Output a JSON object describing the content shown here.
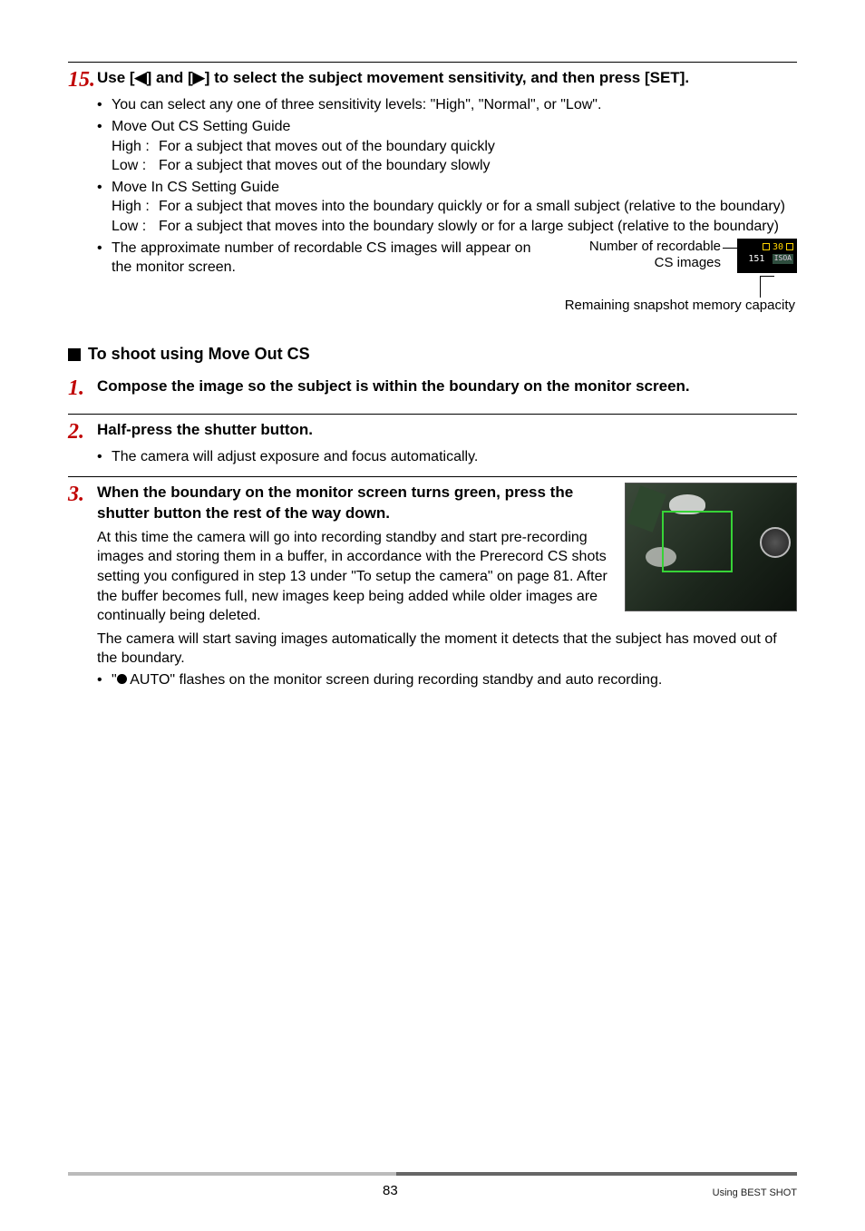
{
  "step15": {
    "num": "15.",
    "head": "Use [◀] and [▶] to select the subject movement sensitivity, and then press [SET].",
    "b1": "You can select any one of three sensitivity levels: \"High\", \"Normal\", or \"Low\".",
    "b2": "Move Out CS Setting Guide",
    "b2_high_lbl": "High :",
    "b2_high": "For a subject that moves out of the boundary quickly",
    "b2_low_lbl": "Low  :",
    "b2_low": "For a subject that moves out of the boundary slowly",
    "b3": "Move In CS Setting Guide",
    "b3_high_lbl": "High :",
    "b3_high": "For a subject that moves into the boundary quickly or for a small subject (relative to the boundary)",
    "b3_low_lbl": "Low  :",
    "b3_low": "For a subject that moves into the boundary slowly or for a large subject (relative to the boundary)",
    "b4": "The approximate number of recordable CS images will appear on the monitor screen.",
    "recordable_label": "Number of recordable CS images",
    "remaining_label": "Remaining snapshot memory capacity",
    "corner_30": "30",
    "corner_151": "151",
    "corner_iso": "ISOA"
  },
  "subhead": "To shoot using Move Out CS",
  "step1": {
    "num": "1.",
    "head": "Compose the image so the subject is within the boundary on the monitor screen."
  },
  "step2": {
    "num": "2.",
    "head": "Half-press the shutter button.",
    "b1": "The camera will adjust exposure and focus automatically."
  },
  "step3": {
    "num": "3.",
    "head": "When the boundary on the monitor screen turns green, press the shutter button the rest of the way down.",
    "p1": "At this time the camera will go into recording standby and start pre-recording images and storing them in a buffer, in accordance with the Prerecord CS shots setting you configured in step 13 under \"To setup the camera\" on page 81. After the buffer becomes full, new images keep being added while older images are continually being deleted.",
    "p2": "The camera will start saving images automatically the moment it detects that the subject has moved out of the boundary.",
    "b1a": "\"",
    "b1b": " AUTO\" flashes on the monitor screen during recording standby and auto recording."
  },
  "footer": {
    "page": "83",
    "section": "Using BEST SHOT"
  }
}
